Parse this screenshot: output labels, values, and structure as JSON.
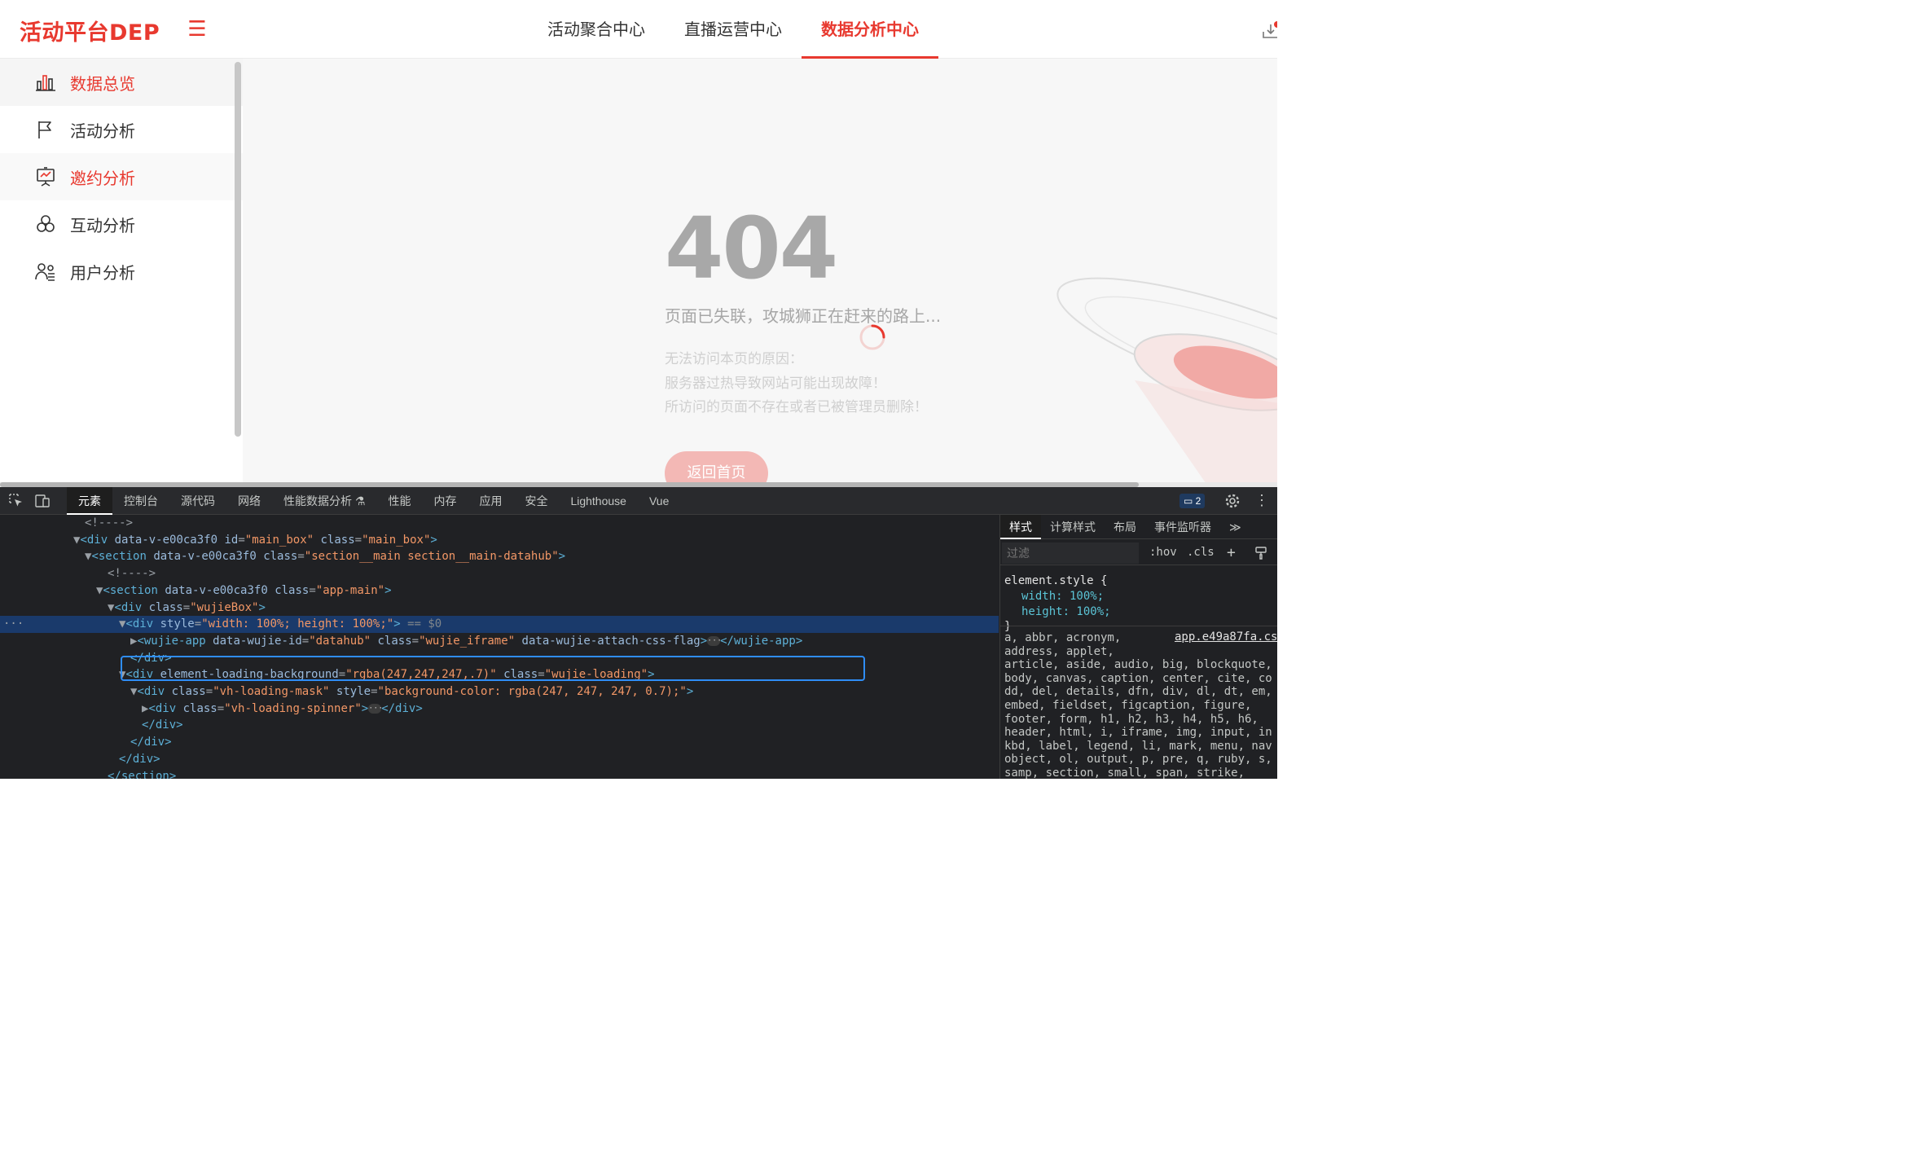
{
  "header": {
    "logo": "活动平台DEP",
    "menu_icon": "hamburger-icon",
    "tabs": [
      {
        "label": "活动聚合中心",
        "active": false
      },
      {
        "label": "直播运营中心",
        "active": false
      },
      {
        "label": "数据分析中心",
        "active": true
      }
    ],
    "brand_color": "#e8392f"
  },
  "sidebar": {
    "items": [
      {
        "label": "数据总览",
        "icon": "bar-chart-icon",
        "state": "active"
      },
      {
        "label": "活动分析",
        "icon": "flag-icon",
        "state": ""
      },
      {
        "label": "邀约分析",
        "icon": "presentation-icon",
        "state": "hover"
      },
      {
        "label": "互动分析",
        "icon": "interaction-icon",
        "state": ""
      },
      {
        "label": "用户分析",
        "icon": "users-icon",
        "state": ""
      }
    ]
  },
  "error_page": {
    "code": "404",
    "headline": "页面已失联，攻城狮正在赶来的路上...",
    "reason_title": "无法访问本页的原因：",
    "reasons": [
      "服务器过热导致网站可能出现故障！",
      "所访问的页面不存在或者已被管理员删除！"
    ],
    "home_button": "返回首页"
  },
  "devtools": {
    "tabs": [
      "元素",
      "控制台",
      "源代码",
      "网络",
      "性能数据分析 ⚗",
      "性能",
      "内存",
      "应用",
      "安全",
      "Lighthouse",
      "Vue"
    ],
    "active_tab": "元素",
    "message_count": "2",
    "styles_tabs": [
      "样式",
      "计算样式",
      "布局",
      "事件监听器",
      "≫"
    ],
    "filter_placeholder": "过滤",
    "hov_label": ":hov",
    "cls_label": ".cls",
    "element_style": {
      "selector": "element.style {",
      "rules": [
        "width: 100%;",
        "height: 100%;"
      ],
      "close": "}"
    },
    "ua_source": "app.e49a87fa.cs",
    "ua_selectors": [
      "a, abbr, acronym,",
      "address, applet,",
      "article, aside, audio, big, blockquote,",
      "body, canvas, caption, center, cite, co",
      "dd, del, details, dfn, div, dl, dt, em,",
      "embed, fieldset, figcaption, figure,",
      "footer, form, h1, h2, h3, h4, h5, h6,",
      "header, html, i, iframe, img, input, in",
      "kbd, label, legend, li, mark, menu, nav",
      "object, ol, output, p, pre, q, ruby, s,",
      "samp, section, small, span, strike,"
    ],
    "dom_lines": [
      {
        "indent": 104,
        "html": "<span class='cmt'>&lt;!----&gt;</span>"
      },
      {
        "indent": 90,
        "html": "<span class='tri'>▼</span><span class='tag'>&lt;div</span> <span class='attr'>data-v-e00ca3f0</span> <span class='attr'>id</span>=<span class='val'>\"main_box\"</span> <span class='attr'>class</span>=<span class='val'>\"main_box\"</span><span class='tag'>&gt;</span>"
      },
      {
        "indent": 104,
        "html": "<span class='tri'>▼</span><span class='tag'>&lt;section</span> <span class='attr'>data-v-e00ca3f0</span> <span class='attr'>class</span>=<span class='val'>\"section__main section__main-datahub\"</span><span class='tag'>&gt;</span>"
      },
      {
        "indent": 132,
        "html": "<span class='cmt'>&lt;!----&gt;</span>"
      },
      {
        "indent": 118,
        "html": "<span class='tri'>▼</span><span class='tag'>&lt;section</span> <span class='attr'>data-v-e00ca3f0</span> <span class='attr'>class</span>=<span class='val'>\"app-main\"</span><span class='tag'>&gt;</span>"
      },
      {
        "indent": 132,
        "html": "<span class='tri'>▼</span><span class='tag'>&lt;div</span> <span class='attr'>class</span>=<span class='val'>\"wujieBox\"</span><span class='tag'>&gt;</span>"
      },
      {
        "indent": 146,
        "html": "<span class='tri'>▼</span><span class='tag'>&lt;div</span> <span class='attr'>style</span>=<span class='val'>\"width: 100%; height: 100%;\"</span><span class='tag'>&gt;</span> <span class='dim'>== $0</span>",
        "selected": true
      },
      {
        "indent": 160,
        "html": "<span class='tri'>▶</span><span class='tag'>&lt;wujie-app</span> <span class='attr'>data-wujie-id</span>=<span class='val'>\"datahub\"</span> <span class='attr'>class</span>=<span class='val'>\"wujie_iframe\"</span> <span class='attr'>data-wujie-attach-css-flag</span><span class='tag'>&gt;</span><span class='ellipsis'>···</span><span class='tag'>&lt;/wujie-app&gt;</span>"
      },
      {
        "indent": 160,
        "html": "<span class='tag'>&lt;/div&gt;</span>"
      },
      {
        "indent": 146,
        "html": "<span class='tri'>▼</span><span class='tag'>&lt;div</span> <span class='attr'>element-loading-background</span>=<span class='val'>\"rgba(247,247,247,.7)\"</span> <span class='attr'>class</span>=<span class='val'>\"wujie-loading\"</span><span class='tag'>&gt;</span>"
      },
      {
        "indent": 160,
        "html": "<span class='tri'>▼</span><span class='tag'>&lt;div</span> <span class='attr'>class</span>=<span class='val'>\"vh-loading-mask\"</span> <span class='attr'>style</span>=<span class='val'>\"background-color: rgba(247, 247, 247, 0.7);\"</span><span class='tag'>&gt;</span>"
      },
      {
        "indent": 174,
        "html": "<span class='tri'>▶</span><span class='tag'>&lt;div</span> <span class='attr'>class</span>=<span class='val'>\"vh-loading-spinner\"</span><span class='tag'>&gt;</span><span class='ellipsis'>···</span><span class='tag'>&lt;/div&gt;</span>"
      },
      {
        "indent": 174,
        "html": "<span class='tag'>&lt;/div&gt;</span>"
      },
      {
        "indent": 160,
        "html": "<span class='tag'>&lt;/div&gt;</span>"
      },
      {
        "indent": 146,
        "html": "<span class='tag'>&lt;/div&gt;</span>"
      },
      {
        "indent": 132,
        "html": "<span class='tag'>&lt;/section&gt;</span>"
      }
    ]
  }
}
